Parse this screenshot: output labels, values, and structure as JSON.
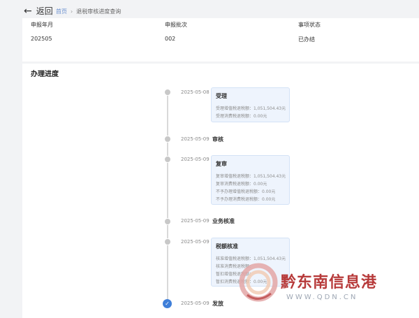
{
  "header": {
    "back_label": "返回",
    "breadcrumb": {
      "home": "首页",
      "current": "退税审核进度查询"
    }
  },
  "summary": {
    "fields": [
      {
        "label": "申报年月",
        "value": "202505"
      },
      {
        "label": "申报批次",
        "value": "002"
      },
      {
        "label": "事项状态",
        "value": "已办结"
      }
    ]
  },
  "progress": {
    "title": "办理进度",
    "steps": [
      {
        "date": "2025-05-08",
        "title": "受理",
        "details": [
          "受理增值税退税额：1,051,504.43元",
          "受理消费税退税额：0.00元"
        ]
      },
      {
        "date": "2025-05-09",
        "title": "审核"
      },
      {
        "date": "2025-05-09",
        "title": "复审",
        "details": [
          "复审增值税退税额：1,051,504.43元",
          "复审消费税退税额：0.00元",
          "不予办理增值税退税额：0.00元",
          "不予办理消费税退税额：0.00元"
        ]
      },
      {
        "date": "2025-05-09",
        "title": "业务核准"
      },
      {
        "date": "2025-05-09",
        "title": "税额核准",
        "details": [
          "核准增值税退税额：1,051,504.43元",
          "核准消费税退税额：",
          "暂扣增值税退税额：",
          "暂扣消费税退税额：0.00元"
        ]
      },
      {
        "date": "2025-05-09",
        "title": "发放",
        "done": true
      }
    ]
  },
  "watermark": {
    "name": "黔东南信息港",
    "url": "WWW.QDN.CN"
  },
  "colors": {
    "accent": "#3f7fd9",
    "box_bg": "#eef4fd",
    "watermark_red": "#b73a3a"
  }
}
